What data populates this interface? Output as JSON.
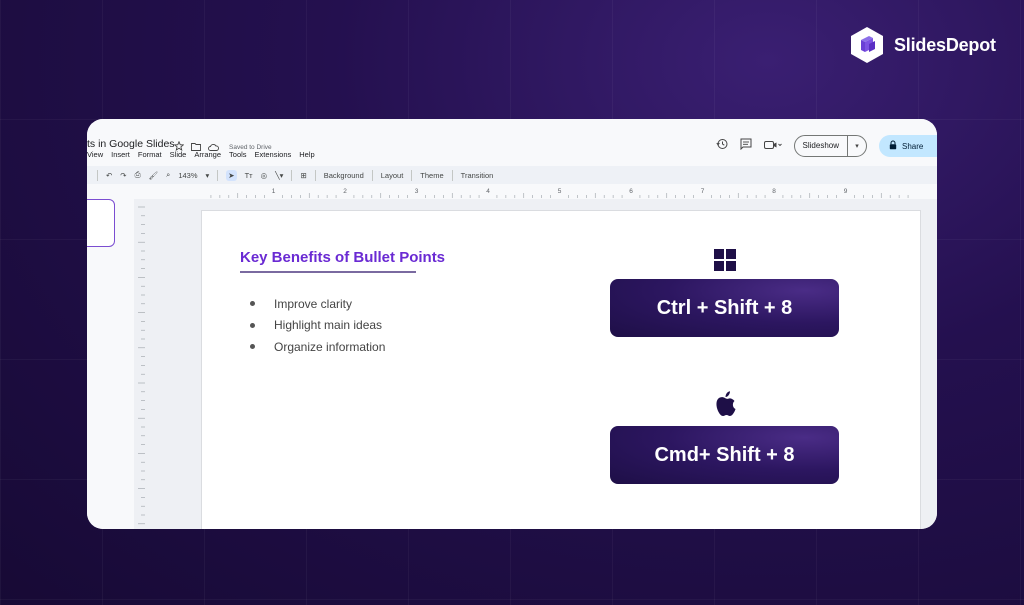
{
  "brand": {
    "name": "SlidesDepot"
  },
  "doc": {
    "title": "ts in Google Slides",
    "saved_status": "Saved to Drive"
  },
  "menu": [
    "View",
    "Insert",
    "Format",
    "Slide",
    "Arrange",
    "Tools",
    "Extensions",
    "Help"
  ],
  "toolbar": {
    "zoom": "143%",
    "background": "Background",
    "layout": "Layout",
    "theme": "Theme",
    "transition": "Transition"
  },
  "ruler_numbers": [
    "1",
    "2",
    "3",
    "4",
    "5",
    "6",
    "7",
    "8",
    "9"
  ],
  "top_right": {
    "slideshow": "Slideshow",
    "share": "Share"
  },
  "slide": {
    "title": "Key Benefits of Bullet Points",
    "bullets": [
      "Improve clarity",
      "Highlight main ideas",
      "Organize information"
    ],
    "windows_shortcut": "Ctrl + Shift + 8",
    "mac_shortcut": "Cmd+ Shift + 8"
  },
  "colors": {
    "accent": "#6a2ad3",
    "share_bg": "#c2e7ff",
    "page_bg": "#24104f"
  },
  "icons": [
    "star-icon",
    "folder-icon",
    "cloud-icon",
    "history-icon",
    "comment-icon",
    "camera-icon",
    "lock-icon",
    "windows-icon",
    "apple-icon"
  ]
}
